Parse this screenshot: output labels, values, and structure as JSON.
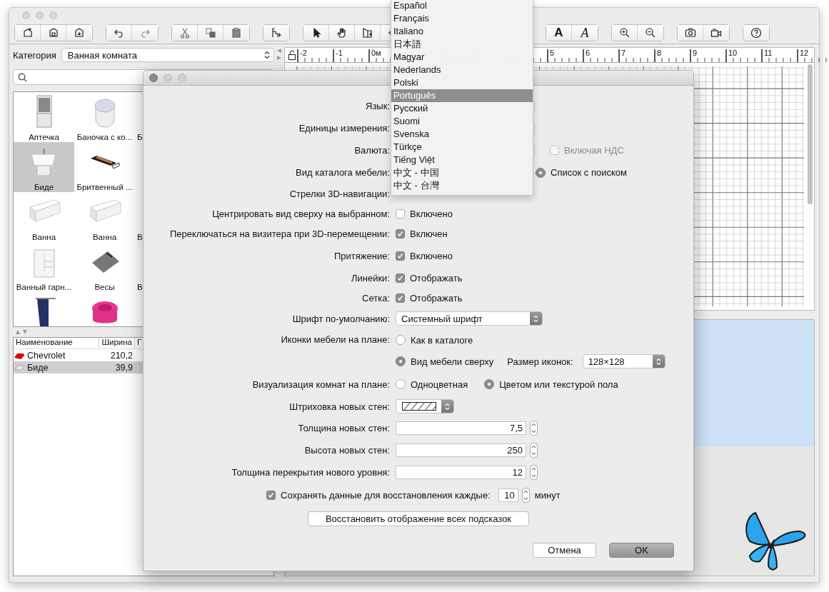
{
  "main_window": {
    "toolbar": {
      "text_style_buttons": [
        "A",
        "A"
      ]
    },
    "catalog": {
      "category_label": "Категория",
      "category_value": "Ванная комната",
      "rows": [
        {
          "items": [
            {
              "label": "Аптечка",
              "selected": false
            },
            {
              "label": "Баночка с ко...",
              "selected": false
            },
            {
              "label": "Б",
              "selected": false
            }
          ]
        },
        {
          "items": [
            {
              "label": "Биде",
              "selected": true
            },
            {
              "label": "Бритвенный ...",
              "selected": false
            }
          ]
        },
        {
          "items": [
            {
              "label": "Ванна",
              "selected": false
            },
            {
              "label": "Ванна",
              "selected": false
            },
            {
              "label": "В",
              "selected": false
            }
          ]
        },
        {
          "items": [
            {
              "label": "Ванный гарн...",
              "selected": false
            },
            {
              "label": "Весы",
              "selected": false
            },
            {
              "label": "В",
              "selected": false
            }
          ]
        },
        {
          "items": [
            {
              "selected": false
            },
            {
              "selected": false
            }
          ]
        }
      ]
    },
    "furniture_table": {
      "columns": [
        "Наименование",
        "Ширина",
        "Г"
      ],
      "rows": [
        {
          "cells": [
            "Chevrolet",
            "210,2"
          ],
          "selected": false
        },
        {
          "cells": [
            "Биде",
            "39,9"
          ],
          "selected": true
        }
      ]
    },
    "plan": {
      "ruler_labels": [
        "-2",
        "-1",
        "0м",
        "5",
        "6",
        "7",
        "8",
        "9",
        "10",
        "11",
        "12"
      ]
    }
  },
  "dialog": {
    "rows": [
      {
        "kind": "select",
        "label": "Язык:"
      },
      {
        "kind": "select",
        "label": "Единицы измерения:"
      },
      {
        "kind": "select",
        "label": "Валюта:",
        "extra": {
          "label": "Включая НДС",
          "checked": false,
          "disabled": true
        }
      },
      {
        "kind": "covered_radios",
        "label": "Вид каталога мебели:",
        "options": [
          {
            "label": "Список с поиском",
            "selected": true
          }
        ]
      },
      {
        "kind": "label_only",
        "label": "Стрелки 3D-навигации:"
      },
      {
        "kind": "checkbox",
        "label": "Центрировать вид сверху на выбранном:",
        "text": "Включено",
        "checked": false
      },
      {
        "kind": "checkbox",
        "label": "Переключаться на визитера при 3D-перемещении:",
        "text": "Включен",
        "checked": true
      },
      {
        "kind": "checkbox",
        "label": "Притяжение:",
        "text": "Включено",
        "checked": true
      },
      {
        "kind": "checkbox",
        "label": "Линейки:",
        "text": "Отображать",
        "checked": true
      },
      {
        "kind": "checkbox",
        "label": "Сетка:",
        "text": "Отображать",
        "checked": true
      },
      {
        "kind": "select",
        "label": "Шрифт по-умолчанию:",
        "value": "Системный шрифт"
      },
      {
        "kind": "stacked_radios",
        "label": "Иконки мебели на плане:",
        "options": [
          {
            "label": "Как в каталоге",
            "selected": false
          },
          {
            "label": "Вид мебели сверху",
            "selected": true
          }
        ],
        "extra": {
          "label": "Размер иконок:",
          "value": "128×128"
        }
      },
      {
        "kind": "radios",
        "label": "Визуализация комнат на плане:",
        "options": [
          {
            "label": "Одноцветная",
            "selected": false
          },
          {
            "label": "Цветом или текстурой пола",
            "selected": true
          }
        ]
      },
      {
        "kind": "pattern",
        "label": "Штриховка новых стен:"
      },
      {
        "kind": "spinner",
        "label": "Толщина новых стен:",
        "value": "7,5"
      },
      {
        "kind": "spinner",
        "label": "Высота новых стен:",
        "value": "250"
      },
      {
        "kind": "spinner",
        "label": "Толщина перекрытия нового уровня:",
        "value": "12"
      }
    ],
    "autosave": {
      "checked": true,
      "label": "Сохранять данные для восстановления каждые:",
      "value": "10",
      "unit": "минут"
    },
    "reset_button": "Восстановить отображение всех подсказок",
    "cancel_button": "Отмена",
    "ok_button": "OK"
  },
  "language_menu": {
    "items": [
      {
        "label": "Español",
        "selected": false
      },
      {
        "label": "Français",
        "selected": false
      },
      {
        "label": "Italiano",
        "selected": false
      },
      {
        "label": "日本語",
        "selected": false
      },
      {
        "label": "Magyar",
        "selected": false
      },
      {
        "label": "Nederlands",
        "selected": false
      },
      {
        "label": "Polski",
        "selected": false
      },
      {
        "label": "Português",
        "selected": true
      },
      {
        "label": "Русский",
        "selected": false
      },
      {
        "label": "Suomi",
        "selected": false
      },
      {
        "label": "Svenska",
        "selected": false
      },
      {
        "label": "Türkçe",
        "selected": false
      },
      {
        "label": "Tiếng Việt",
        "selected": false
      },
      {
        "label": "中文 - 中国",
        "selected": false
      },
      {
        "label": "中文 - 台灣",
        "selected": false
      }
    ]
  }
}
